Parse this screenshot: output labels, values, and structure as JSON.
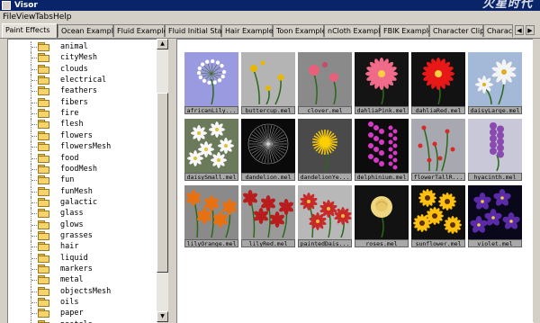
{
  "window": {
    "title": "Visor",
    "watermark": "火星时代"
  },
  "menu": [
    "File",
    "View",
    "Tabs",
    "Help"
  ],
  "tabs": [
    "Paint Effects",
    "Ocean Examples",
    "Fluid Examples",
    "Fluid Initial States",
    "Hair Examples",
    "Toon Examples",
    "nCloth Examples",
    "FBIK Examples",
    "Character Clips",
    "Charac"
  ],
  "active_tab": "Paint Effects",
  "tree": [
    "animal",
    "cityMesh",
    "clouds",
    "electrical",
    "feathers",
    "fibers",
    "fire",
    "flesh",
    "flowers",
    "flowersMesh",
    "food",
    "foodMesh",
    "fun",
    "funMesh",
    "galactic",
    "glass",
    "glows",
    "grasses",
    "hair",
    "liquid",
    "markers",
    "metal",
    "objectsMesh",
    "oils",
    "paper",
    "pastels"
  ],
  "thumbnails": [
    {
      "label": "africanLily...",
      "bg": "#9a9ae0",
      "flower": "#ffffff",
      "type": "lily"
    },
    {
      "label": "buttercup.mel",
      "bg": "#b4b4b4",
      "flower": "#e8b800",
      "type": "buttercup"
    },
    {
      "label": "clover.mel",
      "bg": "#8a8a8a",
      "flower": "#e8607a",
      "type": "clover"
    },
    {
      "label": "dahliaPink.mel",
      "bg": "#141414",
      "flower": "#f06a8a",
      "type": "dahlia"
    },
    {
      "label": "dahliaRed.mel",
      "bg": "#121212",
      "flower": "#e81818",
      "type": "dahlia"
    },
    {
      "label": "daisyLarge.mel",
      "bg": "#a4b8d8",
      "flower": "#f4f4f4",
      "type": "daisy"
    },
    {
      "label": "daisySmall.mel",
      "bg": "#6a7a5a",
      "flower": "#f8f8f8",
      "type": "daisysmall"
    },
    {
      "label": "dandelion.mel",
      "bg": "#0a0a0a",
      "flower": "#dcdcdc",
      "type": "dandelion"
    },
    {
      "label": "dandelionYe...",
      "bg": "#4a4a4a",
      "flower": "#ffd000",
      "type": "dandelionye"
    },
    {
      "label": "delphinium.mel",
      "bg": "#0c0c0c",
      "flower": "#d838c8",
      "type": "spike"
    },
    {
      "label": "flowerTallR...",
      "bg": "#a8a8b0",
      "flower": "#d82828",
      "type": "tallred"
    },
    {
      "label": "hyacinth.mel",
      "bg": "#c8c8d8",
      "flower": "#8a4ab0",
      "type": "hyacinth"
    },
    {
      "label": "lilyOrange.mel",
      "bg": "#8a8a8a",
      "flower": "#e87010",
      "type": "lilyo"
    },
    {
      "label": "lilyRed.mel",
      "bg": "#9a9a9a",
      "flower": "#b81c1c",
      "type": "lilyo"
    },
    {
      "label": "paintedDais...",
      "bg": "#b8b8b8",
      "flower": "#c82a2a",
      "type": "painted"
    },
    {
      "label": "roses.mel",
      "bg": "#121212",
      "flower": "#f0d880",
      "type": "rose"
    },
    {
      "label": "sunflower.mel",
      "bg": "#101010",
      "flower": "#ffc010",
      "type": "sunflower"
    },
    {
      "label": "violet.mel",
      "bg": "#08081a",
      "flower": "#5a2aa8",
      "type": "violet"
    }
  ]
}
